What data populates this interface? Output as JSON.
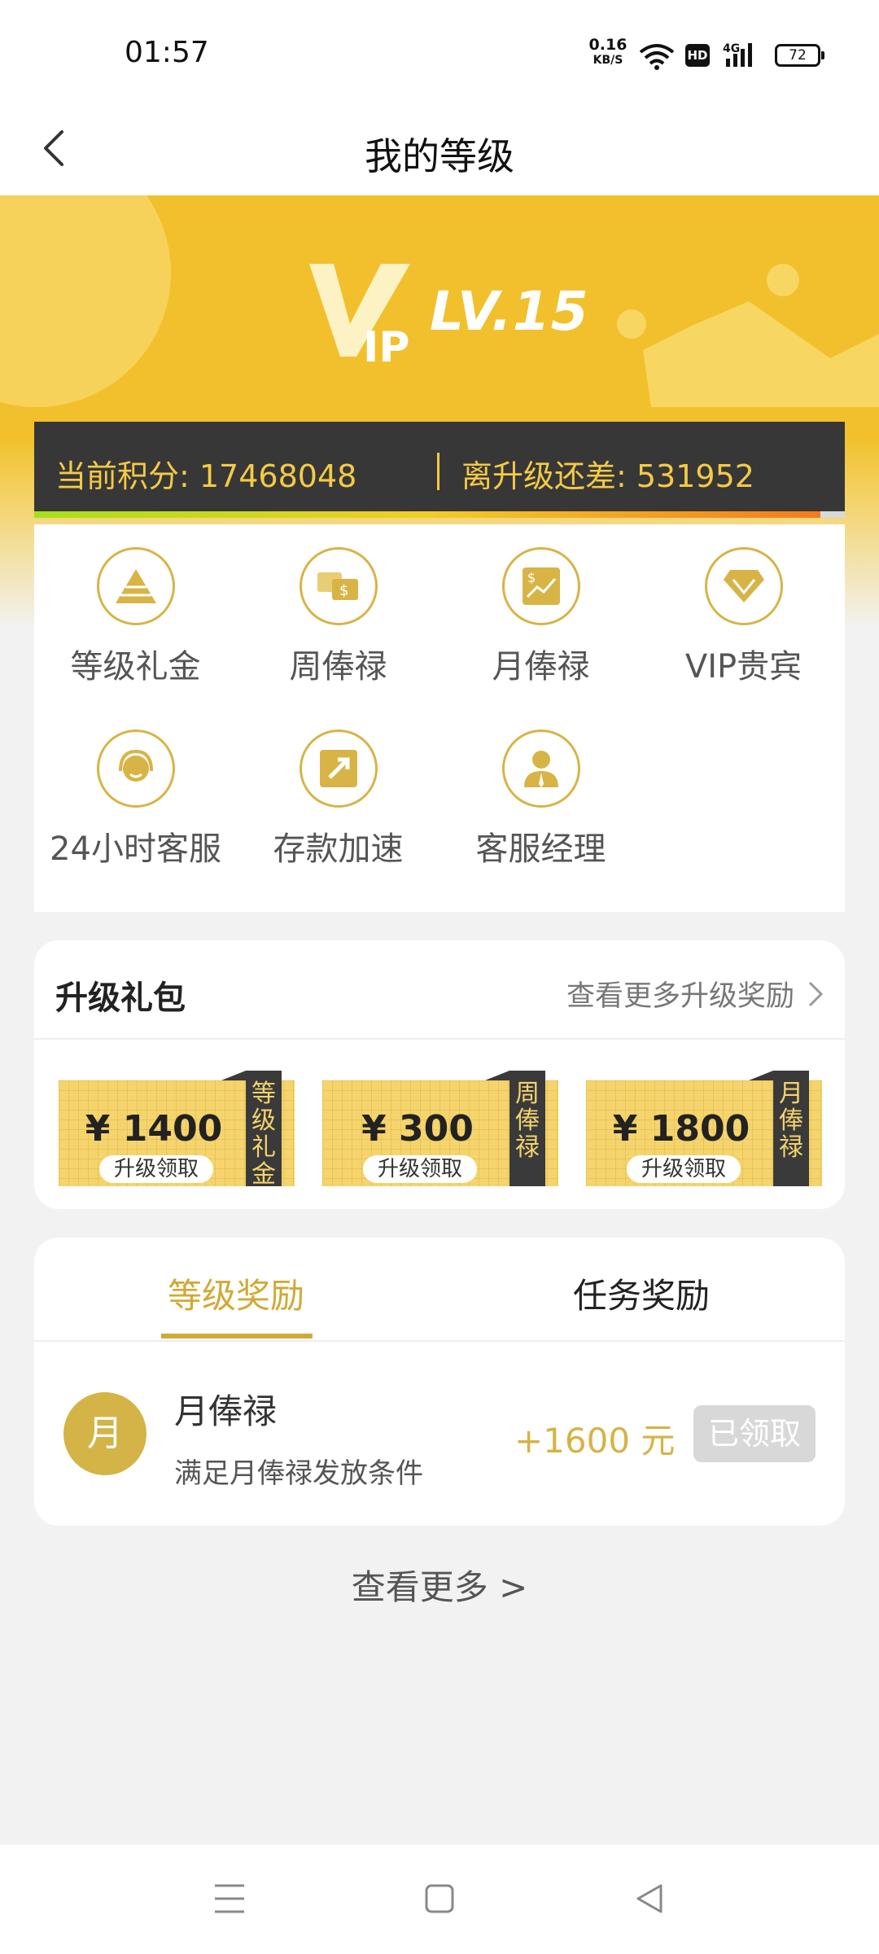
{
  "status_bar": {
    "time": "01:57",
    "speed_value": "0.16",
    "speed_unit": "KB/S",
    "hd": "HD",
    "network": "4G",
    "battery": "72"
  },
  "nav": {
    "title": "我的等级"
  },
  "hero": {
    "vip_logo": "VIP",
    "level": "LV.15"
  },
  "points": {
    "current": "当前积分: 17468048",
    "remaining": "离升级还差: 531952",
    "progress": 0.97
  },
  "perks": [
    {
      "label": "等级礼金",
      "icon": "pyramid-icon"
    },
    {
      "label": "周俸禄",
      "icon": "money-chat-icon"
    },
    {
      "label": "月俸禄",
      "icon": "chart-money-icon"
    },
    {
      "label": "VIP贵宾",
      "icon": "diamond-icon"
    },
    {
      "label": "24小时客服",
      "icon": "headset-icon"
    },
    {
      "label": "存款加速",
      "icon": "rocket-icon"
    },
    {
      "label": "客服经理",
      "icon": "manager-icon"
    }
  ],
  "upgrade_pack": {
    "title": "升级礼包",
    "more": "查看更多升级奖励",
    "tickets": [
      {
        "amount": "¥ 1400",
        "action": "升级领取",
        "tag": "等级礼金"
      },
      {
        "amount": "¥ 300",
        "action": "升级领取",
        "tag": "周俸禄"
      },
      {
        "amount": "¥ 1800",
        "action": "升级领取",
        "tag": "月俸禄"
      }
    ]
  },
  "rewards": {
    "tabs": [
      "等级奖励",
      "任务奖励"
    ],
    "item": {
      "avatar": "月",
      "name": "月俸禄",
      "desc": "满足月俸禄发放条件",
      "amount": "+1600 元",
      "button": "已领取"
    }
  },
  "see_more": "查看更多 >",
  "colors": {
    "gold": "#f1c02c",
    "accent": "#d4b447",
    "dark": "#373737"
  }
}
